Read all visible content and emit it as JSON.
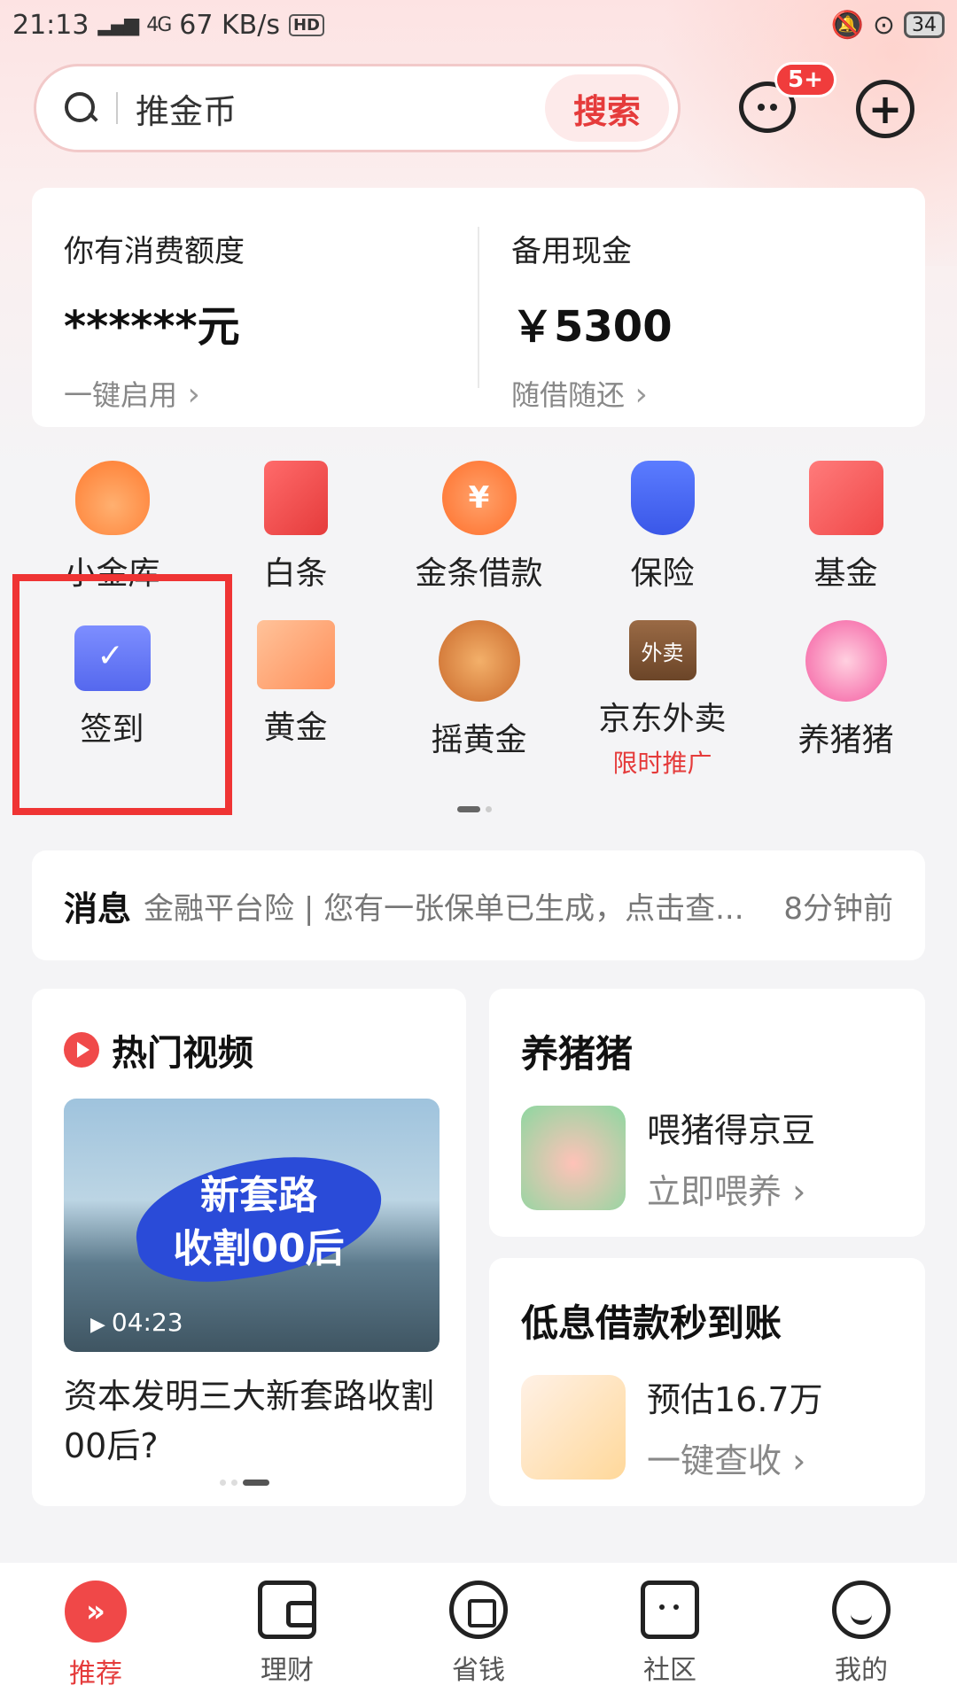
{
  "status_bar": {
    "time": "21:13",
    "network": "4G",
    "speed": "67 KB/s",
    "hd": "HD",
    "battery": "34"
  },
  "search": {
    "placeholder": "推金币",
    "button_label": "搜索"
  },
  "header": {
    "message_badge": "5+",
    "add_label": "+"
  },
  "credit": {
    "left": {
      "label": "你有消费额度",
      "value": "******元",
      "action": "一键启用"
    },
    "right": {
      "label": "备用现金",
      "value": "￥5300",
      "action": "随借随还"
    }
  },
  "grid": {
    "row1": [
      {
        "label": "小金库",
        "icon": "piggy-bag-icon"
      },
      {
        "label": "白条",
        "icon": "bill-icon"
      },
      {
        "label": "金条借款",
        "icon": "coin-loan-icon",
        "glyph": "¥"
      },
      {
        "label": "保险",
        "icon": "shield-umbrella-icon"
      },
      {
        "label": "基金",
        "icon": "fund-chart-icon"
      }
    ],
    "row2": [
      {
        "label": "签到",
        "icon": "calendar-check-icon"
      },
      {
        "label": "黄金",
        "icon": "gold-bars-icon"
      },
      {
        "label": "摇黄金",
        "icon": "gold-coins-bowl-icon"
      },
      {
        "label": "京东外卖",
        "icon": "takeout-bag-icon",
        "glyph": "外卖",
        "sub": "限时推广"
      },
      {
        "label": "养猪猪",
        "icon": "piggy-icon"
      }
    ]
  },
  "message": {
    "title": "消息",
    "text": "金融平台险 | 您有一张保单已生成，点击查...",
    "time": "8分钟前"
  },
  "video_card": {
    "title": "热门视频",
    "thumb_text_1": "新套路",
    "thumb_text_2": "收割00后",
    "duration": "04:23",
    "caption": "资本发明三大新套路收割00后?"
  },
  "pig_card": {
    "title": "养猪猪",
    "line1": "喂猪得京豆",
    "line2": "立即喂养"
  },
  "loan_card": {
    "title": "低息借款秒到账",
    "line1": "预估16.7万",
    "line2": "一键查收"
  },
  "bottom_nav": [
    {
      "label": "推荐",
      "icon": "home-chevron-icon",
      "glyph": "»"
    },
    {
      "label": "理财",
      "icon": "wallet-icon"
    },
    {
      "label": "省钱",
      "icon": "save-money-icon"
    },
    {
      "label": "社区",
      "icon": "chat-community-icon"
    },
    {
      "label": "我的",
      "icon": "smiley-profile-icon"
    }
  ],
  "colors": {
    "accent": "#e53b3b",
    "highlight_box": "#ef3434",
    "background": "#f4f4f6"
  }
}
